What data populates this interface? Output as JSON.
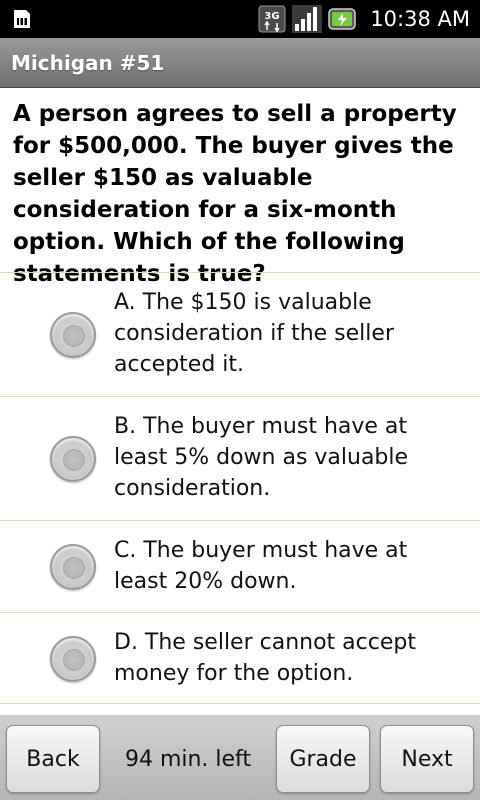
{
  "status_bar": {
    "time": "10:38 AM",
    "network_label": "3G",
    "icons": [
      "sim-card-icon",
      "3g-data-icon",
      "signal-strength-icon",
      "battery-charging-icon"
    ]
  },
  "title_bar": {
    "title": "Michigan #51"
  },
  "question": {
    "text": "A person agrees to sell a property for $500,000. The buyer gives the seller $150 as valuable consideration for a six-month option. Which of the following statements is true?"
  },
  "options": [
    {
      "label": "A. The $150 is valuable consideration if the seller accepted it.",
      "selected": false
    },
    {
      "label": "B. The buyer must have at least 5% down as valuable consideration.",
      "selected": false
    },
    {
      "label": "C. The buyer must have at least 20% down.",
      "selected": false
    },
    {
      "label": "D. The seller cannot accept money for the option.",
      "selected": false
    }
  ],
  "bottom_bar": {
    "back_label": "Back",
    "time_left": "94 min. left",
    "grade_label": "Grade",
    "next_label": "Next"
  },
  "colors": {
    "status_bar_bg": "#000000",
    "title_bar_bg": "#8a8a8a",
    "divider": "#cfe3b4",
    "bottom_bar_bg": "#c4c4c4"
  }
}
